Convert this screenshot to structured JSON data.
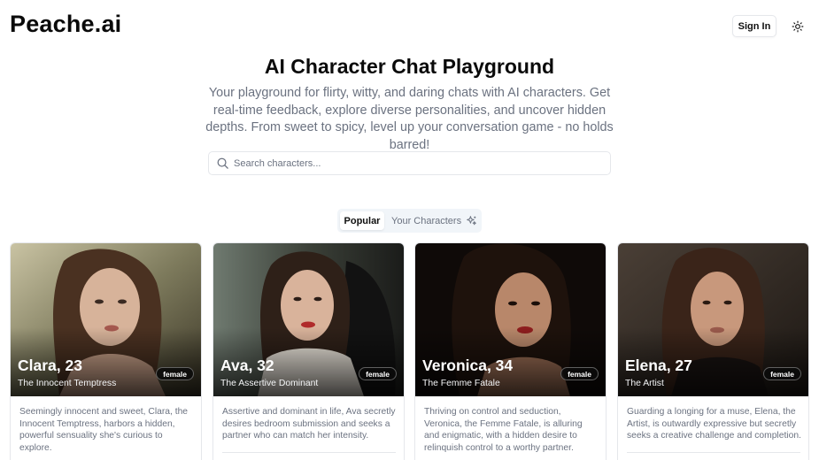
{
  "header": {
    "logo": "Peache.ai",
    "signin_label": "Sign In",
    "theme_icon": "sun-icon"
  },
  "hero": {
    "title": "AI Character Chat Playground",
    "subtitle": "Your playground for flirty, witty, and daring chats with AI characters. Get real-time feedback, explore diverse personalities, and uncover hidden depths. From sweet to spicy, level up your conversation game - no holds barred!"
  },
  "search": {
    "placeholder": "Search characters...",
    "value": "",
    "icon": "search-icon"
  },
  "tabs": [
    {
      "label": "Popular",
      "active": true
    },
    {
      "label": "Your Characters",
      "active": false,
      "icon": "sparkles-icon"
    }
  ],
  "characters": [
    {
      "name": "Clara, 23",
      "role": "The Innocent Temptress",
      "badge": "female",
      "description": "Seemingly innocent and sweet, Clara, the Innocent Temptress, harbors a hidden, powerful sensuality she's curious to explore."
    },
    {
      "name": "Ava, 32",
      "role": "The Assertive Dominant",
      "badge": "female",
      "description": "Assertive and dominant in life, Ava secretly desires bedroom submission and seeks a partner who can match her intensity."
    },
    {
      "name": "Veronica, 34",
      "role": "The Femme Fatale",
      "badge": "female",
      "description": "Thriving on control and seduction, Veronica, the Femme Fatale, is alluring and enigmatic, with a hidden desire to relinquish control to a worthy partner."
    },
    {
      "name": "Elena, 27",
      "role": "The Artist",
      "badge": "female",
      "description": "Guarding a longing for a muse, Elena, the Artist, is outwardly expressive but secretly seeks a creative challenge and completion."
    }
  ]
}
